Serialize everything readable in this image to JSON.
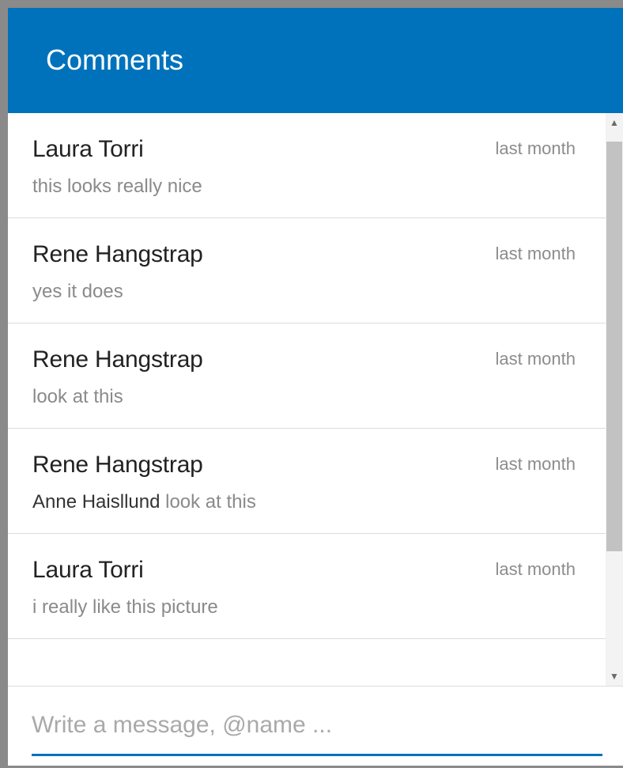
{
  "header": {
    "title": "Comments"
  },
  "comments": [
    {
      "author": "Laura Torri",
      "time": "last month",
      "mention": "",
      "message": "this looks really nice"
    },
    {
      "author": "Rene Hangstrap",
      "time": "last month",
      "mention": "",
      "message": "yes it does"
    },
    {
      "author": "Rene Hangstrap",
      "time": "last month",
      "mention": "",
      "message": "look at this"
    },
    {
      "author": "Rene Hangstrap",
      "time": "last month",
      "mention": "Anne Haisllund",
      "message": "look at this"
    },
    {
      "author": "Laura Torri",
      "time": "last month",
      "mention": "",
      "message": "i really like this picture"
    }
  ],
  "composer": {
    "placeholder": "Write a message, @name ..."
  },
  "scrollbar": {
    "up_glyph": "▲",
    "down_glyph": "▼"
  },
  "colors": {
    "accent": "#0072bb",
    "header_text": "#ffffff",
    "author_text": "#222222",
    "message_text": "#8a8a8a",
    "time_text": "#8c8c8c"
  }
}
